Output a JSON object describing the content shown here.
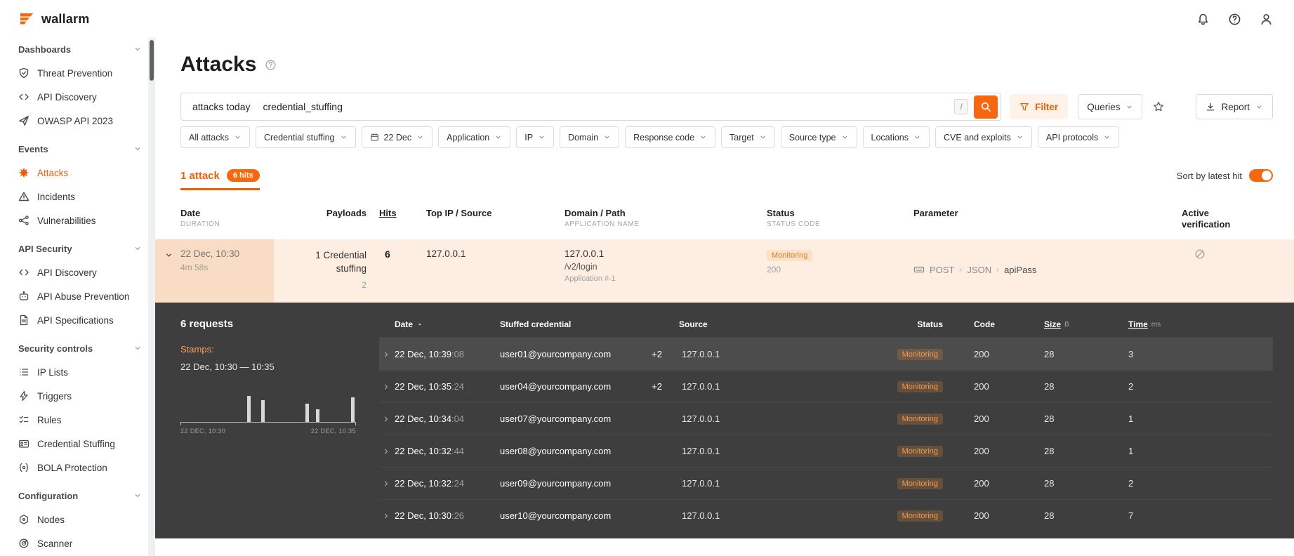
{
  "brand": {
    "name": "wallarm"
  },
  "page": {
    "title": "Attacks"
  },
  "search": {
    "tokens": [
      "attacks today",
      "credential_stuffing"
    ],
    "shortcut_key": "/"
  },
  "toolbar": {
    "filter_label": "Filter",
    "queries_label": "Queries",
    "report_label": "Report"
  },
  "filters": {
    "chips": [
      {
        "label": "All attacks"
      },
      {
        "label": "Credential stuffing"
      },
      {
        "label": "22 Dec",
        "icon": "calendar"
      },
      {
        "label": "Application"
      },
      {
        "label": "IP"
      },
      {
        "label": "Domain"
      },
      {
        "label": "Response code"
      },
      {
        "label": "Target"
      },
      {
        "label": "Source type"
      },
      {
        "label": "Locations"
      },
      {
        "label": "CVE and exploits"
      },
      {
        "label": "API protocols"
      }
    ]
  },
  "results": {
    "tab_label": "1 attack",
    "hits_badge": "6 hits",
    "sort_label": "Sort by latest hit"
  },
  "attack_table": {
    "headers": {
      "date": {
        "title": "Date",
        "sub": "DURATION"
      },
      "payloads": {
        "title": "Payloads"
      },
      "hits": {
        "title": "Hits"
      },
      "source": {
        "title": "Top IP / Source"
      },
      "domain": {
        "title": "Domain / Path",
        "sub": "APPLICATION NAME"
      },
      "status": {
        "title": "Status",
        "sub": "STATUS CODE"
      },
      "parameter": {
        "title": "Parameter"
      },
      "verification": {
        "title": "Active verification"
      }
    },
    "row": {
      "date": "22 Dec, 10:30",
      "duration": "4m 58s",
      "payload": "1 Credential stuffing",
      "payload_count": "2",
      "hits": "6",
      "top_ip": "127.0.0.1",
      "domain": "127.0.0.1",
      "path": "/v2/login",
      "application": "Application #-1",
      "status": "Monitoring",
      "status_code": "200",
      "parameter": {
        "method": "POST",
        "sep1": "›",
        "format": "JSON",
        "sep2": "›",
        "name": "apiPass"
      }
    }
  },
  "details": {
    "requests_count": "6 requests",
    "stamps_label": "Stamps:",
    "stamps_range": "22 Dec, 10:30 — 10:35",
    "chart_data": {
      "type": "bar",
      "x_start_label": "22 DEC, 10:30",
      "x_end_label": "22 DEC, 10:35",
      "bars": [
        {
          "pos": 0.38,
          "h": 1.0
        },
        {
          "pos": 0.46,
          "h": 0.85
        },
        {
          "pos": 0.71,
          "h": 0.7
        },
        {
          "pos": 0.77,
          "h": 0.5
        },
        {
          "pos": 0.97,
          "h": 0.95
        }
      ]
    },
    "table": {
      "headers": {
        "date": "Date",
        "credential": "Stuffed credential",
        "source": "Source",
        "status": "Status",
        "code": "Code",
        "size": "Size",
        "size_unit": "B",
        "time": "Time",
        "time_unit": "ms"
      },
      "rows": [
        {
          "highlight": true,
          "time": "22 Dec, 10:39",
          "secs": ":08",
          "credential": "user01@yourcompany.com",
          "extra": "+2",
          "source": "127.0.0.1",
          "status": "Monitoring",
          "code": "200",
          "size": "28",
          "duration": "3"
        },
        {
          "time": "22 Dec, 10:35",
          "secs": ":24",
          "credential": "user04@yourcompany.com",
          "extra": "+2",
          "source": "127.0.0.1",
          "status": "Monitoring",
          "code": "200",
          "size": "28",
          "duration": "2"
        },
        {
          "time": "22 Dec, 10:34",
          "secs": ":04",
          "credential": "user07@yourcompany.com",
          "source": "127.0.0.1",
          "status": "Monitoring",
          "code": "200",
          "size": "28",
          "duration": "1"
        },
        {
          "time": "22 Dec, 10:32",
          "secs": ":44",
          "credential": "user08@yourcompany.com",
          "source": "127.0.0.1",
          "status": "Monitoring",
          "code": "200",
          "size": "28",
          "duration": "1"
        },
        {
          "time": "22 Dec, 10:32",
          "secs": ":24",
          "credential": "user09@yourcompany.com",
          "source": "127.0.0.1",
          "status": "Monitoring",
          "code": "200",
          "size": "28",
          "duration": "2"
        },
        {
          "time": "22 Dec, 10:30",
          "secs": ":26",
          "credential": "user10@yourcompany.com",
          "source": "127.0.0.1",
          "status": "Monitoring",
          "code": "200",
          "size": "28",
          "duration": "7"
        }
      ]
    }
  },
  "sidebar": {
    "entries": [
      {
        "is_section": true,
        "label": "Dashboards"
      },
      {
        "is_item": true,
        "label": "Threat Prevention",
        "icon": "shield"
      },
      {
        "is_item": true,
        "label": "API Discovery",
        "icon": "code"
      },
      {
        "is_item": true,
        "label": "OWASP API 2023",
        "icon": "plane"
      },
      {
        "is_section": true,
        "label": "Events"
      },
      {
        "is_item": true,
        "label": "Attacks",
        "icon": "burst",
        "active": true
      },
      {
        "is_item": true,
        "label": "Incidents",
        "icon": "warning"
      },
      {
        "is_item": true,
        "label": "Vulnerabilities",
        "icon": "nodes"
      },
      {
        "is_section": true,
        "label": "API Security"
      },
      {
        "is_item": true,
        "label": "API Discovery",
        "icon": "code"
      },
      {
        "is_item": true,
        "label": "API Abuse Prevention",
        "icon": "bot"
      },
      {
        "is_item": true,
        "label": "API Specifications",
        "icon": "doc"
      },
      {
        "is_section": true,
        "label": "Security controls"
      },
      {
        "is_item": true,
        "label": "IP Lists",
        "icon": "list"
      },
      {
        "is_item": true,
        "label": "Triggers",
        "icon": "bolt"
      },
      {
        "is_item": true,
        "label": "Rules",
        "icon": "rules"
      },
      {
        "is_item": true,
        "label": "Credential Stuffing",
        "icon": "card"
      },
      {
        "is_item": true,
        "label": "BOLA Protection",
        "icon": "bola"
      },
      {
        "is_section": true,
        "label": "Configuration"
      },
      {
        "is_item": true,
        "label": "Nodes",
        "icon": "hexnode"
      },
      {
        "is_item": true,
        "label": "Scanner",
        "icon": "radar"
      }
    ]
  },
  "colors": {
    "accent": "#f25c07",
    "accent_button": "#f5680f",
    "panel_bg": "#3e3e3e",
    "row_highlight": "#fdeee1",
    "row_cell_highlight": "#f9dcc4",
    "monitoring_badge_bg": "#fae1c8",
    "monitoring_badge_text": "#d9812f"
  }
}
